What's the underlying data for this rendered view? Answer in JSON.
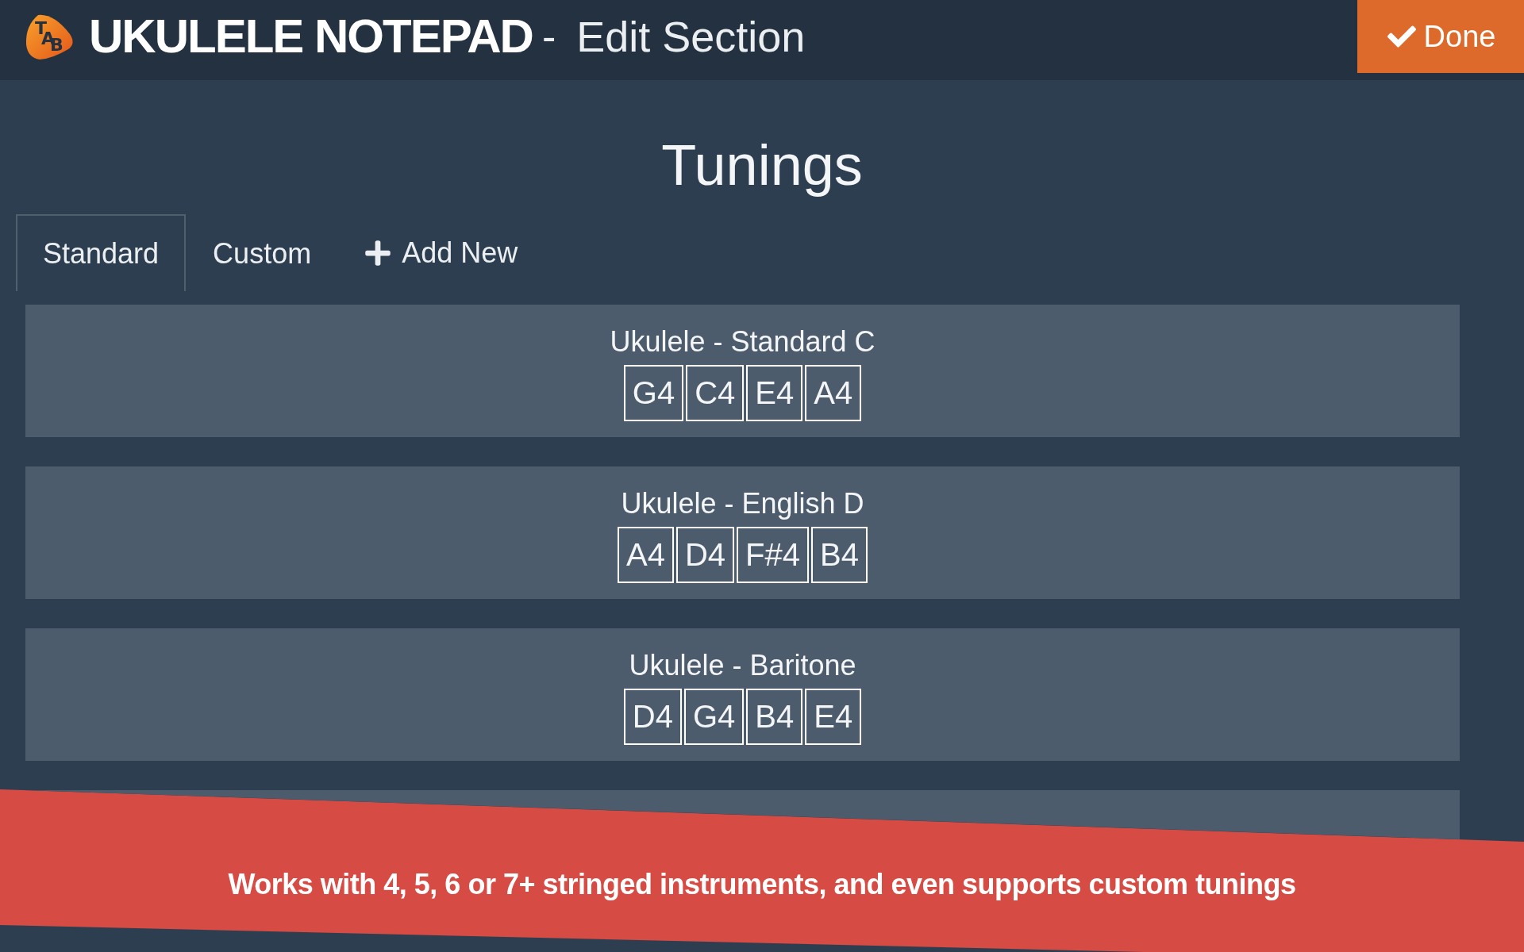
{
  "header": {
    "logo_letters": [
      "T",
      "A",
      "B"
    ],
    "app_name": "UKULELE NOTEPAD",
    "separator": "-",
    "page_title": "Edit Section",
    "done_button": {
      "label": "Done"
    }
  },
  "heading": "Tunings",
  "tabs": [
    {
      "label": "Standard",
      "selected": true
    },
    {
      "label": "Custom",
      "selected": false
    }
  ],
  "add_button": {
    "label": "Add New"
  },
  "tunings": [
    {
      "name": "Ukulele - Standard C",
      "notes": [
        "G4",
        "C4",
        "E4",
        "A4"
      ]
    },
    {
      "name": "Ukulele - English D",
      "notes": [
        "A4",
        "D4",
        "F#4",
        "B4"
      ]
    },
    {
      "name": "Ukulele - Baritone",
      "notes": [
        "D4",
        "G4",
        "B4",
        "E4"
      ]
    }
  ],
  "partly_hidden_card": true,
  "banner": {
    "text": "Works with 4, 5, 6 or 7+ stringed instruments, and even supports custom tunings"
  }
}
